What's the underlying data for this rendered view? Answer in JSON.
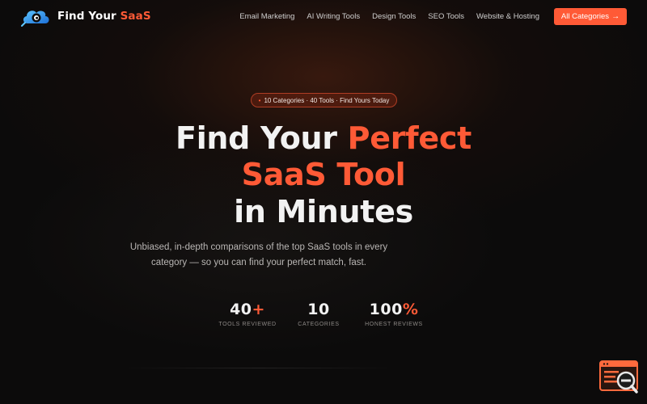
{
  "brand": {
    "name_main": "Find Your ",
    "name_accent": "SaaS",
    "accent_color": "#ff5a36"
  },
  "nav": {
    "items": [
      {
        "label": "Email Marketing"
      },
      {
        "label": "AI Writing Tools"
      },
      {
        "label": "Design Tools"
      },
      {
        "label": "SEO Tools"
      },
      {
        "label": "Website & Hosting"
      }
    ],
    "cta_label": "All Categories",
    "cta_arrow": "→"
  },
  "badge": {
    "dot": "•",
    "text": "10 Categories · 40 Tools · Find Yours Today"
  },
  "hero": {
    "line1_main": "Find Your ",
    "line1_accent": "Perfect",
    "line2": "SaaS Tool",
    "line3": "in Minutes"
  },
  "subtitle": {
    "line1": "Unbiased, in-depth comparisons of the top SaaS tools in every",
    "line2": "category — so you can find your perfect match, fast."
  },
  "stats": [
    {
      "value": "40",
      "suffix": "+",
      "label": "TOOLS REVIEWED"
    },
    {
      "value": "10",
      "suffix": "",
      "label": "CATEGORIES"
    },
    {
      "value": "100",
      "suffix": "%",
      "label": "HONEST REVIEWS"
    }
  ],
  "icons": {
    "logo": "cloud-eye-icon",
    "widget": "browser-search-icon"
  }
}
